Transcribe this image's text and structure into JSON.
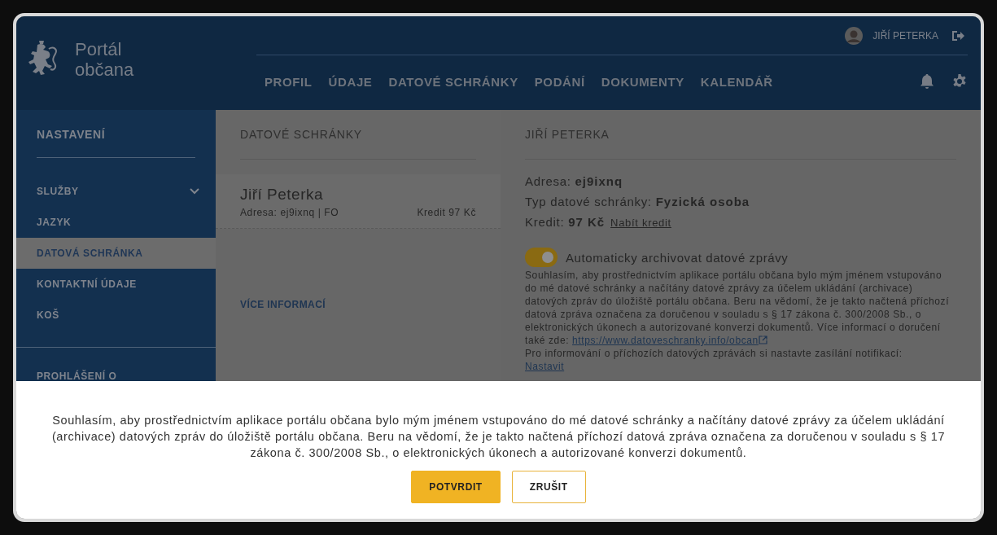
{
  "header": {
    "logo_lines": [
      "Portál",
      "občana"
    ],
    "user_name": "JIŘÍ PETERKA",
    "nav": [
      {
        "label": "PROFIL"
      },
      {
        "label": "ÚDAJE"
      },
      {
        "label": "DATOVÉ SCHRÁNKY"
      },
      {
        "label": "PODÁNÍ"
      },
      {
        "label": "DOKUMENTY"
      },
      {
        "label": "KALENDÁŘ"
      }
    ]
  },
  "sidebar": {
    "title": "NASTAVENÍ",
    "items": [
      {
        "label": "SLUŽBY",
        "kind": "group",
        "expanded": false,
        "selected": false
      },
      {
        "label": "JAZYK",
        "kind": "link",
        "selected": false
      },
      {
        "label": "DATOVÁ SCHRÁNKA",
        "kind": "link",
        "selected": true
      },
      {
        "label": "KONTAKTNÍ ÚDAJE",
        "kind": "link",
        "selected": false
      },
      {
        "label": "KOŠ",
        "kind": "link",
        "selected": false
      }
    ],
    "footer_item": "PROHLÁŠENÍ O"
  },
  "mailboxes": {
    "title": "DATOVÉ SCHRÁNKY",
    "card": {
      "name": "Jiří Peterka",
      "address": "Adresa: ej9ixnq | FO",
      "credit": "Kredit 97 Kč"
    },
    "more_link": "VÍCE INFORMACÍ"
  },
  "detail": {
    "title": "JIŘÍ PETERKA",
    "fields": [
      {
        "label": "Adresa:",
        "value": "ej9ixnq"
      },
      {
        "label": "Typ datové schránky:",
        "value": "Fyzická osoba"
      },
      {
        "label": "Kredit:",
        "value": "97 Kč",
        "link": "Nabít kredit"
      }
    ],
    "toggle": {
      "on": true,
      "label": "Automaticky archivovat datové zprávy"
    },
    "consent_text": "Souhlasím, aby prostřednictvím aplikace portálu občana bylo mým jménem vstupováno do mé datové schránky a načítány datové zprávy za účelem ukládání (archivace) datových zpráv do úložiště portálu občana. Beru na vědomí, že je takto načtená příchozí datová zpráva označena za doručenou v souladu s § 17 zákona č. 300/2008 Sb., o elektronických úkonech a autorizované konverzi dokumentů. Více informací o doručení také zde:",
    "consent_link": "https://www.datoveschranky.info/obcan",
    "notif_text": "Pro informování o příchozích datových zprávách si nastavte zasílání notifikací:",
    "notif_link": "Nastavit"
  },
  "dialog": {
    "text": "Souhlasím, aby prostřednictvím aplikace portálu občana bylo mým jménem vstupováno do mé datové schránky a načítány datové zprávy za účelem ukládání (archivace) datových zpráv do úložiště portálu občana. Beru na vědomí, že je takto načtená příchozí datová zpráva označena za doručenou v souladu s § 17 zákona č. 300/2008 Sb., o elektronických úkonech a autorizované konverzi dokumentů.",
    "buttons": [
      {
        "label": "POTVRDIT",
        "kind": "primary"
      },
      {
        "label": "ZRUŠIT",
        "kind": "secondary"
      }
    ]
  }
}
